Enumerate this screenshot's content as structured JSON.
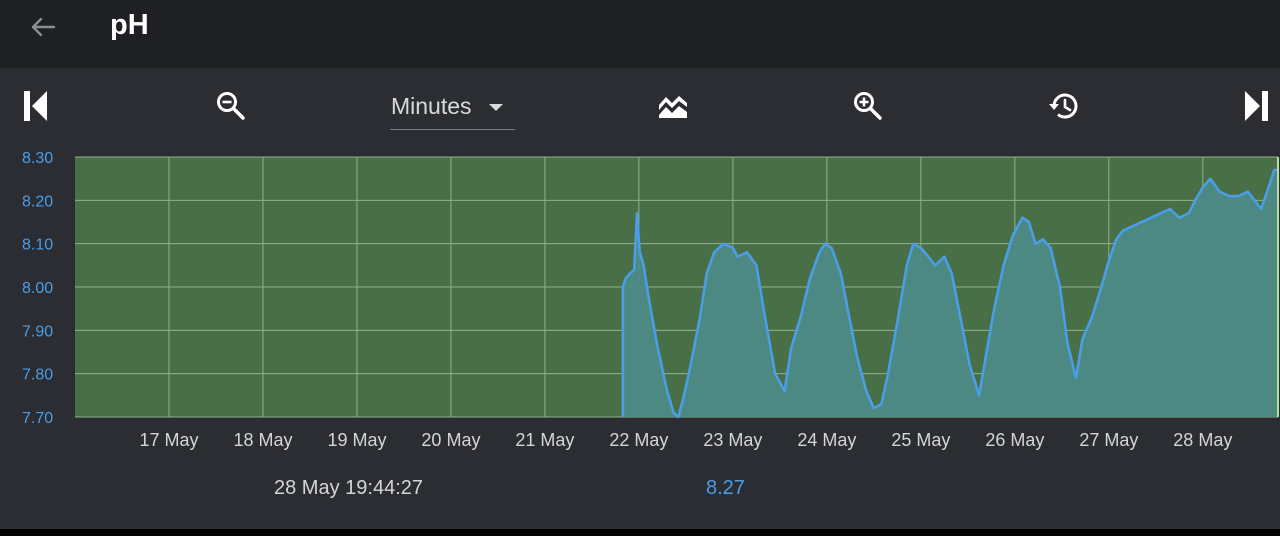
{
  "header": {
    "title": "pH",
    "back_icon": "arrow-left-icon"
  },
  "toolbar": {
    "first_icon": "skip-to-start-icon",
    "zoom_out_icon": "zoom-out-icon",
    "interval": "Minutes",
    "chart_style_icon": "area-chart-icon",
    "zoom_in_icon": "zoom-in-icon",
    "history_icon": "history-icon",
    "last_icon": "skip-to-end-icon"
  },
  "colors": {
    "plot_background": "#486f45",
    "line": "#4a9ee8",
    "fill": "#4e8a87",
    "grid": "#8fb38a",
    "axis_text": "#4a9ee8",
    "date_text": "#d4d5d7"
  },
  "chart_data": {
    "type": "area",
    "title": "",
    "xlabel": "",
    "ylabel": "",
    "ylim": [
      7.7,
      8.3
    ],
    "y_ticks": [
      "8.30",
      "8.20",
      "8.10",
      "8.00",
      "7.90",
      "7.80",
      "7.70"
    ],
    "x_ticks": [
      "17 May",
      "18 May",
      "19 May",
      "20 May",
      "21 May",
      "22 May",
      "23 May",
      "24 May",
      "25 May",
      "26 May",
      "27 May",
      "28 May"
    ],
    "xlim_days": [
      16.0,
      28.8
    ],
    "grid": true,
    "series": [
      {
        "values": [
          [
            21.83,
            7.7
          ],
          [
            21.83,
            8.0
          ],
          [
            21.86,
            8.02
          ],
          [
            21.9,
            8.03
          ],
          [
            21.95,
            8.04
          ],
          [
            21.98,
            8.17
          ],
          [
            22.01,
            8.08
          ],
          [
            22.05,
            8.05
          ],
          [
            22.1,
            7.98
          ],
          [
            22.2,
            7.86
          ],
          [
            22.3,
            7.76
          ],
          [
            22.37,
            7.71
          ],
          [
            22.42,
            7.7
          ],
          [
            22.48,
            7.75
          ],
          [
            22.55,
            7.82
          ],
          [
            22.65,
            7.93
          ],
          [
            22.72,
            8.03
          ],
          [
            22.8,
            8.08
          ],
          [
            22.9,
            8.1
          ],
          [
            23.0,
            8.09
          ],
          [
            23.05,
            8.07
          ],
          [
            23.15,
            8.08
          ],
          [
            23.25,
            8.05
          ],
          [
            23.35,
            7.92
          ],
          [
            23.45,
            7.8
          ],
          [
            23.55,
            7.76
          ],
          [
            23.62,
            7.86
          ],
          [
            23.72,
            7.93
          ],
          [
            23.82,
            8.02
          ],
          [
            23.92,
            8.08
          ],
          [
            23.98,
            8.1
          ],
          [
            24.05,
            8.09
          ],
          [
            24.15,
            8.03
          ],
          [
            24.22,
            7.95
          ],
          [
            24.32,
            7.84
          ],
          [
            24.42,
            7.76
          ],
          [
            24.5,
            7.72
          ],
          [
            24.58,
            7.73
          ],
          [
            24.65,
            7.8
          ],
          [
            24.75,
            7.92
          ],
          [
            24.85,
            8.05
          ],
          [
            24.92,
            8.1
          ],
          [
            25.0,
            8.09
          ],
          [
            25.08,
            8.07
          ],
          [
            25.15,
            8.05
          ],
          [
            25.25,
            8.07
          ],
          [
            25.33,
            8.03
          ],
          [
            25.42,
            7.93
          ],
          [
            25.52,
            7.82
          ],
          [
            25.62,
            7.75
          ],
          [
            25.7,
            7.85
          ],
          [
            25.78,
            7.95
          ],
          [
            25.88,
            8.05
          ],
          [
            25.98,
            8.12
          ],
          [
            26.08,
            8.16
          ],
          [
            26.15,
            8.15
          ],
          [
            26.22,
            8.1
          ],
          [
            26.3,
            8.11
          ],
          [
            26.38,
            8.09
          ],
          [
            26.48,
            8.0
          ],
          [
            26.56,
            7.87
          ],
          [
            26.65,
            7.79
          ],
          [
            26.72,
            7.88
          ],
          [
            26.82,
            7.93
          ],
          [
            26.92,
            8.0
          ],
          [
            27.0,
            8.06
          ],
          [
            27.08,
            8.11
          ],
          [
            27.15,
            8.13
          ],
          [
            27.25,
            8.14
          ],
          [
            27.35,
            8.15
          ],
          [
            27.45,
            8.16
          ],
          [
            27.55,
            8.17
          ],
          [
            27.65,
            8.18
          ],
          [
            27.75,
            8.16
          ],
          [
            27.85,
            8.17
          ],
          [
            27.92,
            8.2
          ],
          [
            28.0,
            8.23
          ],
          [
            28.08,
            8.25
          ],
          [
            28.18,
            8.22
          ],
          [
            28.28,
            8.21
          ],
          [
            28.38,
            8.21
          ],
          [
            28.48,
            8.22
          ],
          [
            28.55,
            8.2
          ],
          [
            28.62,
            8.18
          ],
          [
            28.7,
            8.23
          ],
          [
            28.76,
            8.27
          ],
          [
            28.8,
            8.27
          ]
        ]
      }
    ]
  },
  "footer": {
    "timestamp": "28 May 19:44:27",
    "value": "8.27"
  }
}
